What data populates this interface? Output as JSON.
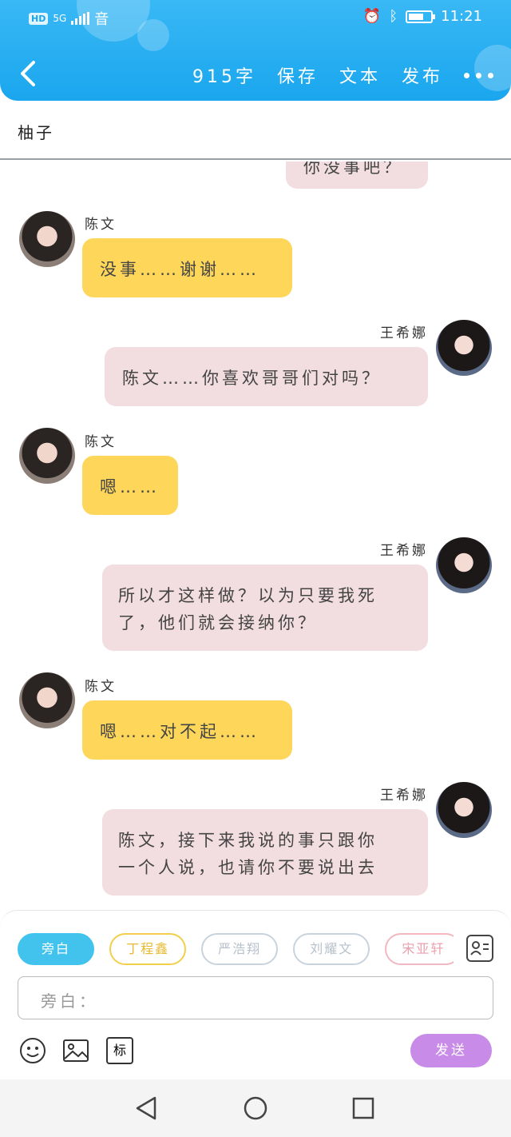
{
  "status": {
    "network": "5G",
    "time": "11:21",
    "hd": "HD"
  },
  "header": {
    "word_count": "915字",
    "save": "保存",
    "text": "文本",
    "publish": "发布"
  },
  "title": "柚子",
  "messages": [
    {
      "side": "right",
      "speaker": "",
      "text": "你没事吧？"
    },
    {
      "side": "left",
      "speaker": "陈文",
      "text": "没事……谢谢……"
    },
    {
      "side": "right",
      "speaker": "王希娜",
      "text": "陈文……你喜欢哥哥们对吗？"
    },
    {
      "side": "left",
      "speaker": "陈文",
      "text": "嗯……"
    },
    {
      "side": "right",
      "speaker": "王希娜",
      "text_line1": "所以才这样做？以为只要我死",
      "text_line2": "了，他们就会接纳你？"
    },
    {
      "side": "left",
      "speaker": "陈文",
      "text": "嗯……对不起……"
    },
    {
      "side": "right",
      "speaker": "王希娜",
      "text_line1": "陈文，接下来我说的事只跟你",
      "text_line2": "一个人说，也请你不要说出去"
    }
  ],
  "characters": [
    {
      "label": "旁白",
      "color": "#41c3ee",
      "active": true
    },
    {
      "label": "丁程鑫",
      "color": "#f2cf4a",
      "active": false
    },
    {
      "label": "严浩翔",
      "color": "#c9d3dd",
      "active": false
    },
    {
      "label": "刘耀文",
      "color": "#c9d3dd",
      "active": false
    },
    {
      "label": "宋亚轩",
      "color": "#f2b8c2",
      "active": false
    },
    {
      "label": "",
      "color": "#7fd6cf",
      "active": false
    }
  ],
  "composer": {
    "placeholder": "旁白：",
    "send_label": "发送",
    "tag_label": "标"
  }
}
